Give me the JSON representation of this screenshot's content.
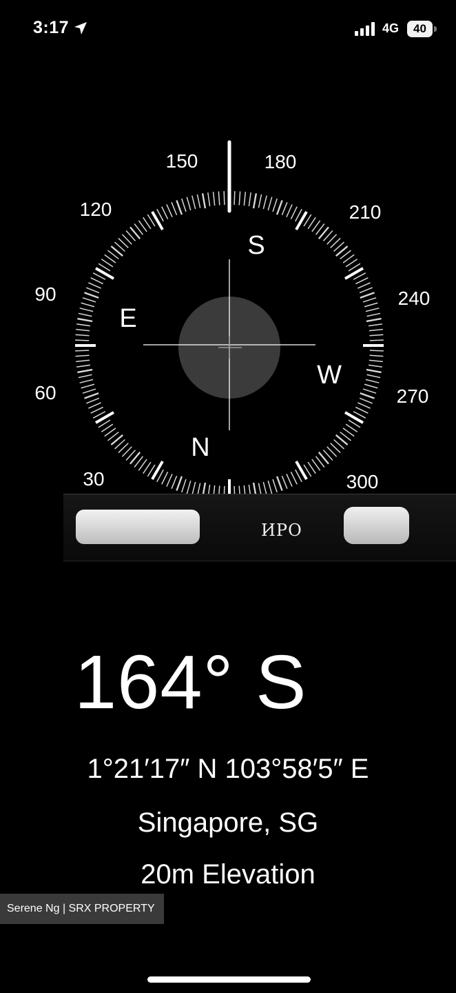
{
  "status_bar": {
    "time": "3:17",
    "network": "4G",
    "battery": "40"
  },
  "compass": {
    "heading_degrees": 164,
    "degree_labels": [
      "150",
      "180",
      "120",
      "210",
      "90",
      "240",
      "60",
      "270",
      "30",
      "300"
    ],
    "cardinals": {
      "north": "N",
      "east": "E",
      "south": "S",
      "west": "W"
    }
  },
  "controls": {
    "center_label": "ИРО"
  },
  "readout": {
    "heading": "164° S",
    "coordinates": "1°21′17″ N  103°58′5″ E",
    "location": "Singapore, SG",
    "elevation": "20m Elevation"
  },
  "watermark": {
    "text": "Serene Ng | SRX PROPERTY"
  }
}
